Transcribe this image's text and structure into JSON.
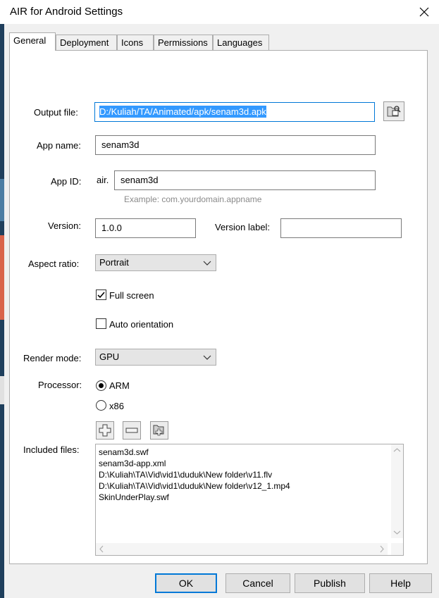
{
  "window": {
    "title": "AIR for Android Settings",
    "close_glyph": "✕"
  },
  "tabs": [
    "General",
    "Deployment",
    "Icons",
    "Permissions",
    "Languages"
  ],
  "output_file": {
    "label": "Output file:",
    "value": "D:/Kuliah/TA/Animated/apk/senam3d.apk",
    "browse_icon": "folder-browse-icon"
  },
  "app_name": {
    "label": "App name:",
    "value": "senam3d"
  },
  "app_id": {
    "label": "App ID:",
    "prefix": "air.",
    "value": "senam3d",
    "hint": "Example: com.yourdomain.appname"
  },
  "version": {
    "label": "Version:",
    "value": "1.0.0",
    "label_field_label": "Version label:",
    "label_value": ""
  },
  "aspect_ratio": {
    "label": "Aspect ratio:",
    "selected": "Portrait"
  },
  "full_screen": {
    "label": "Full screen",
    "checked": true
  },
  "auto_orientation": {
    "label": "Auto orientation",
    "checked": false
  },
  "render_mode": {
    "label": "Render mode:",
    "selected": "GPU"
  },
  "processor": {
    "label": "Processor:",
    "options": [
      "ARM",
      "x86"
    ],
    "selected": "ARM"
  },
  "file_buttons": [
    "add-file-icon",
    "remove-file-icon",
    "add-folder-icon"
  ],
  "included_files": {
    "label": "Included files:",
    "items": [
      "senam3d.swf",
      "senam3d-app.xml",
      "D:\\Kuliah\\TA\\Vid\\vid1\\duduk\\New folder\\v11.flv",
      "D:\\Kuliah\\TA\\Vid\\vid1\\duduk\\New folder\\v12_1.mp4",
      "SkinUnderPlay.swf"
    ]
  },
  "buttons": {
    "ok": "OK",
    "cancel": "Cancel",
    "publish": "Publish",
    "help": "Help"
  }
}
